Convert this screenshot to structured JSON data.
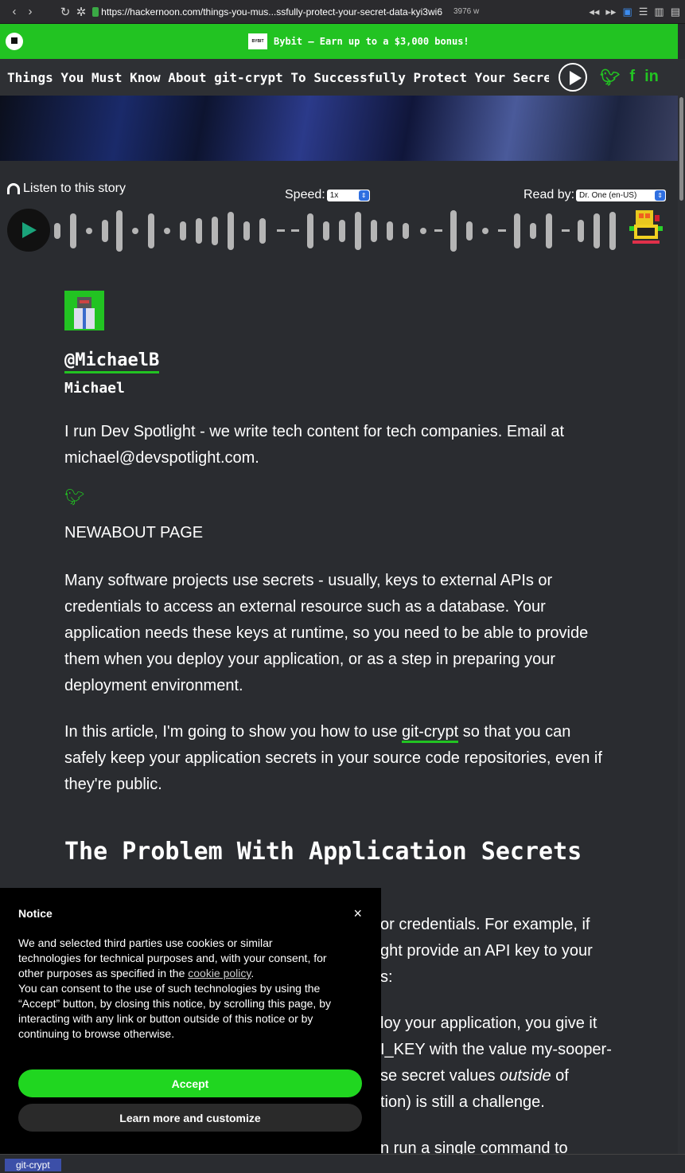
{
  "browser": {
    "url": "https://hackernoon.com/things-you-mus...ssfully-protect-your-secret-data-kyi3wi6",
    "word_count": "3976 w"
  },
  "header": {
    "promo_badge": "BYBIT",
    "promo_text": "Bybit – Earn up to a $3,000 bonus!",
    "accent_color": "#22c322"
  },
  "title_bar": {
    "title": "Things You Must Know About git-crypt To Successfully Protect Your Secret Data"
  },
  "audio": {
    "listen_label": "Listen to this story",
    "speed_label": "Speed:",
    "speed_value": "1x",
    "readby_label": "Read by:",
    "voice_value": "Dr. One (en-US)"
  },
  "author": {
    "handle": "@MichaelB",
    "name": "Michael",
    "bio": "I run Dev Spotlight - we write tech content for tech companies. Email at michael@devspotlight.com.",
    "about_link": "NEWABOUT PAGE"
  },
  "article": {
    "p1": "Many software projects use secrets - usually, keys to external APIs or credentials to access an external resource such as a database. Your application needs these keys at runtime, so you need to be able to provide them when you deploy your application, or as a step in preparing your deployment environment.",
    "p2_before": "In this article, I'm going to show you how to use ",
    "p2_link": "git-crypt",
    "p2_after": " so that you can safely keep your application secrets in your source code repositories, even if they're public.",
    "h2": "The Problem With Application Secrets",
    "hidden_lines": [
      "or credentials. For example, if",
      "ght provide an API key to your",
      "s:",
      "loy your application, you give it",
      "I_KEY with the value my-sooper-",
      "se secret values ",
      "outside",
      " of",
      "tion) is still a challenge.",
      "n run a single command to"
    ]
  },
  "notice": {
    "title": "Notice",
    "close": "×",
    "body_1": "We and selected third parties use cookies or similar technologies for technical purposes and, with your consent, for other purposes as specified in the ",
    "cookie_link": "cookie policy",
    "body_2": ".",
    "body_3": "You can consent to the use of such technologies by using the “Accept” button, by closing this notice, by scrolling this page, by interacting with any link or button outside of this notice or by continuing to browse otherwise.",
    "accept": "Accept",
    "learn_more": "Learn more and customize"
  },
  "status": {
    "tag": "git-crypt"
  }
}
